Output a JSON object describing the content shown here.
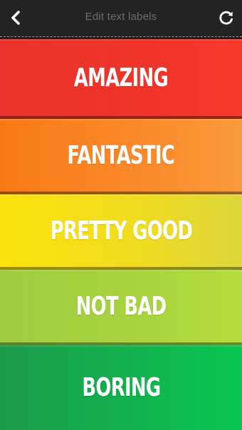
{
  "header": {
    "title": "Edit text labels",
    "back_icon": "chevron-left-icon",
    "reset_icon": "refresh-icon"
  },
  "labels": [
    {
      "text": "AMAZING",
      "color": "#f0342a"
    },
    {
      "text": "FANTASTIC",
      "color": "#fa8a2a"
    },
    {
      "text": "PRETTY GOOD",
      "color": "#f1dc1f"
    },
    {
      "text": "NOT BAD",
      "color": "#a8d43e"
    },
    {
      "text": "BORING",
      "color": "#12b24e"
    }
  ]
}
